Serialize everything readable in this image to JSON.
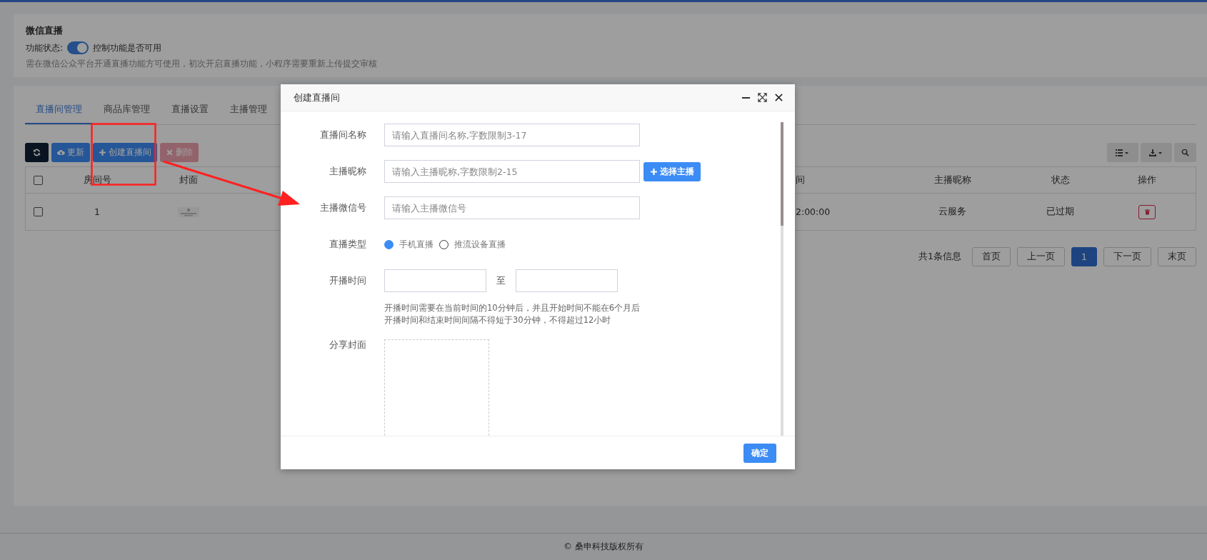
{
  "header_card": {
    "title": "微信直播",
    "status_label": "功能状态:",
    "toggle": {
      "on": true
    },
    "toggle_hint": "控制功能是否可用",
    "note": "需在微信公众平台开通直播功能方可使用，初次开启直播功能，小程序需要重新上传提交审核"
  },
  "tabs": [
    {
      "label": "直播间管理",
      "selected": true
    },
    {
      "label": "商品库管理",
      "selected": false
    },
    {
      "label": "直播设置",
      "selected": false
    },
    {
      "label": "主播管理",
      "selected": false
    }
  ],
  "toolbar": {
    "buttons": [
      {
        "kind": "refresh",
        "disabled": false
      },
      {
        "kind": "update",
        "label": "更新",
        "disabled": false
      },
      {
        "kind": "create",
        "label": "创建直播间",
        "disabled": false
      },
      {
        "kind": "delete",
        "label": "删除",
        "disabled": true
      }
    ],
    "right_buttons": [
      {
        "kind": "columns"
      },
      {
        "kind": "export"
      },
      {
        "kind": "search"
      }
    ]
  },
  "table": {
    "header_checkbox": {
      "checked": false
    },
    "columns": [
      "房间号",
      "封面",
      "间",
      "主播昵称",
      "状态",
      "操作"
    ],
    "rows": [
      {
        "checked": false,
        "room_no": "1",
        "column_4": "2:00:00",
        "anchor": "云服务",
        "status": "已过期"
      }
    ]
  },
  "pagination": {
    "summary": "共1条信息",
    "pages": [
      {
        "label": "首页",
        "selected": false
      },
      {
        "label": "上一页",
        "selected": false
      },
      {
        "label": "1",
        "selected": true
      },
      {
        "label": "下一页",
        "selected": false
      },
      {
        "label": "末页",
        "selected": false
      }
    ]
  },
  "dialog": {
    "title": "创建直播间",
    "fields": [
      {
        "kind": "text",
        "label": "直播间名称",
        "placeholder": "请输入直播间名称,字数限制3-17"
      },
      {
        "kind": "text",
        "label": "主播昵称",
        "placeholder": "请输入主播昵称,字数限制2-15",
        "button": "选择主播"
      },
      {
        "kind": "text",
        "label": "主播微信号",
        "placeholder": "请输入主播微信号"
      },
      {
        "kind": "radio",
        "label": "直播类型",
        "options": [
          {
            "label": "手机直播",
            "selected": true
          },
          {
            "label": "推流设备直播",
            "selected": false
          }
        ]
      },
      {
        "kind": "time_range",
        "label": "开播时间",
        "separator": "至",
        "hints": [
          "开播时间需要在当前时间的10分钟后，并且开始时间不能在6个月后",
          "开播时间和结束时间间隔不得短于30分钟，不得超过12小时"
        ]
      },
      {
        "kind": "upload",
        "label": "分享封面"
      }
    ],
    "confirm": "确定"
  },
  "footer": "© 桑申科技版权所有"
}
